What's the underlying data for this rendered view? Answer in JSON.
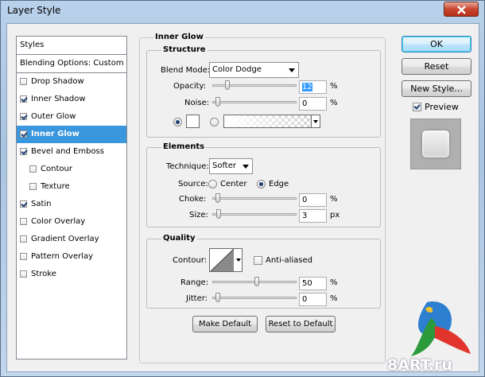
{
  "window": {
    "title": "Layer Style"
  },
  "styles_list": {
    "header": "Styles",
    "blending_options": "Blending Options: Custom",
    "items": [
      {
        "label": "Drop Shadow",
        "checked": false
      },
      {
        "label": "Inner Shadow",
        "checked": true
      },
      {
        "label": "Outer Glow",
        "checked": true
      },
      {
        "label": "Inner Glow",
        "checked": true,
        "selected": true
      },
      {
        "label": "Bevel and Emboss",
        "checked": true
      },
      {
        "label": "Contour",
        "checked": false,
        "indent": true
      },
      {
        "label": "Texture",
        "checked": false,
        "indent": true
      },
      {
        "label": "Satin",
        "checked": true
      },
      {
        "label": "Color Overlay",
        "checked": false
      },
      {
        "label": "Gradient Overlay",
        "checked": false
      },
      {
        "label": "Pattern Overlay",
        "checked": false
      },
      {
        "label": "Stroke",
        "checked": false
      }
    ]
  },
  "panel": {
    "title": "Inner Glow",
    "structure": {
      "title": "Structure",
      "blend_mode_label": "Blend Mode:",
      "blend_mode_value": "Color Dodge",
      "opacity_label": "Opacity:",
      "opacity_value": "12",
      "opacity_unit": "%",
      "opacity_level": 0.12,
      "noise_label": "Noise:",
      "noise_value": "0",
      "noise_unit": "%",
      "noise_level": 0,
      "color_swatch": "#ffffff"
    },
    "elements": {
      "title": "Elements",
      "technique_label": "Technique:",
      "technique_value": "Softer",
      "source_label": "Source:",
      "source_center": "Center",
      "source_edge": "Edge",
      "choke_label": "Choke:",
      "choke_value": "0",
      "choke_unit": "%",
      "choke_level": 0,
      "size_label": "Size:",
      "size_value": "3",
      "size_unit": "px",
      "size_level": 0.012
    },
    "quality": {
      "title": "Quality",
      "contour_label": "Contour:",
      "anti_aliased_label": "Anti-aliased",
      "range_label": "Range:",
      "range_value": "50",
      "range_unit": "%",
      "range_level": 0.5,
      "jitter_label": "Jitter:",
      "jitter_value": "0",
      "jitter_unit": "%",
      "jitter_level": 0
    },
    "make_default": "Make Default",
    "reset_to_default": "Reset to Default"
  },
  "buttons": {
    "ok": "OK",
    "reset": "Reset",
    "new_style": "New Style...",
    "preview_label": "Preview"
  },
  "watermark": {
    "text": "8ART.ru"
  }
}
